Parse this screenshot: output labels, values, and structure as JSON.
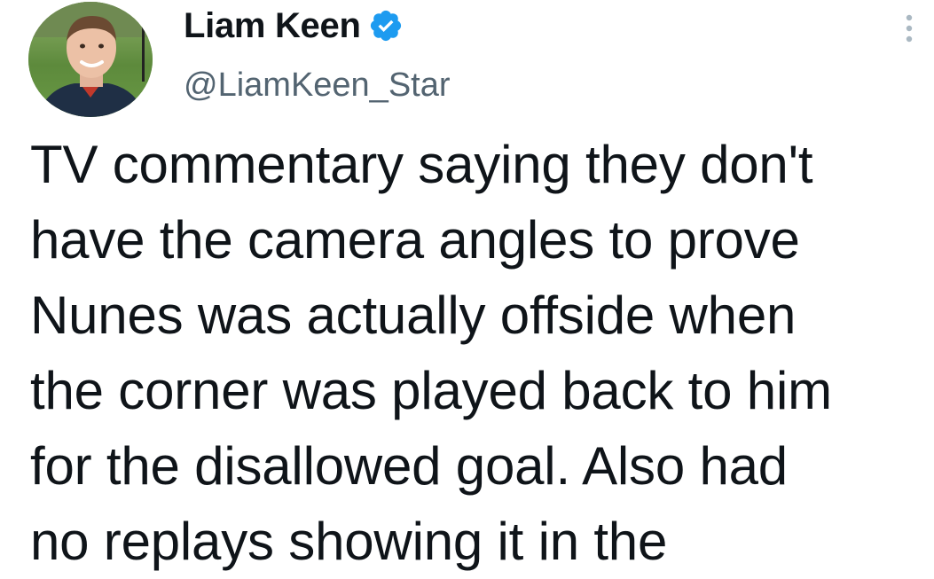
{
  "author": {
    "name": "Liam Keen",
    "handle": "@LiamKeen_Star",
    "verified": true
  },
  "colors": {
    "text_primary": "#0f1419",
    "text_secondary": "#536471",
    "verified_badge": "#1d9bf0",
    "background": "#ffffff"
  },
  "icons": {
    "verified": "verified-badge-icon",
    "more": "more-options-icon",
    "avatar": "profile-avatar"
  },
  "tweet": {
    "text": "TV commentary saying they don't\nhave the camera angles to prove\nNunes was actually offside when\nthe corner was played back to him\nfor the disallowed goal. Also had\nno replays showing it in the"
  }
}
